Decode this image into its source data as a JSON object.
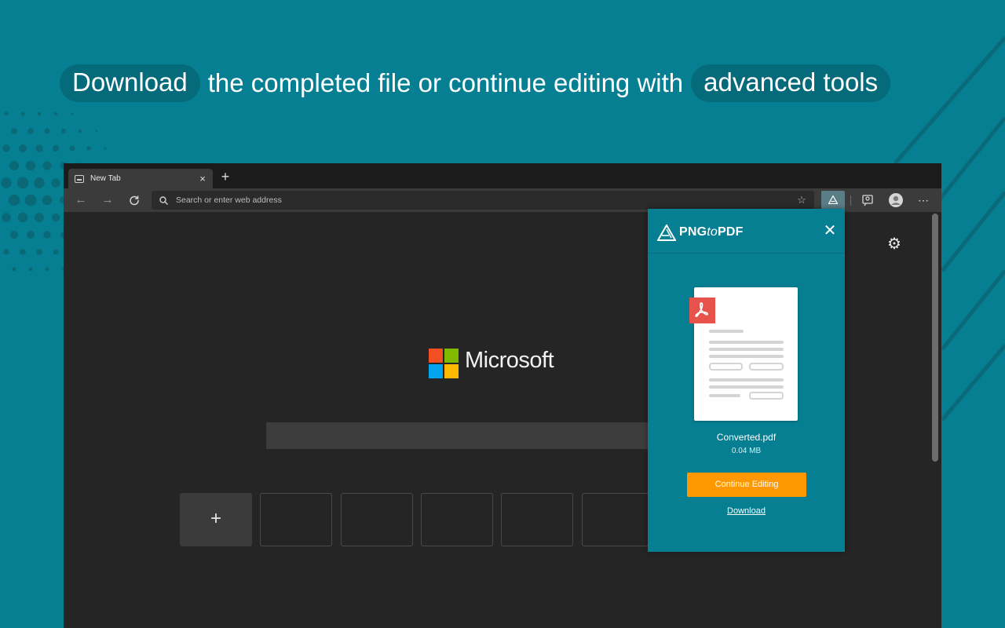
{
  "headline": {
    "highlight_1": "Download",
    "middle": "the completed file or continue editing with",
    "highlight_2": "advanced tools"
  },
  "browser": {
    "tab": {
      "title": "New Tab",
      "close_glyph": "×"
    },
    "new_tab_glyph": "+",
    "address_placeholder": "Search or enter web address",
    "nav": {
      "back_glyph": "←",
      "forward_glyph": "→"
    },
    "more_glyph": "⋯"
  },
  "page": {
    "logo_text": "Microsoft",
    "add_tile_glyph": "+",
    "settings_glyph": "⚙"
  },
  "popup": {
    "brand_prefix": "PNG",
    "brand_to": "to",
    "brand_suffix": "PDF",
    "close_glyph": "✕",
    "file_name": "Converted.pdf",
    "file_size": "0.04 MB",
    "continue_label": "Continue Editing",
    "download_label": "Download"
  },
  "colors": {
    "background": "#057f91",
    "pill": "#056b7b",
    "accent_orange": "#ff9800",
    "pdf_red": "#e5534b",
    "ms_red": "#f25022",
    "ms_green": "#7fba00",
    "ms_blue": "#00a4ef",
    "ms_yellow": "#ffb900"
  },
  "icons": [
    "tab-page-icon",
    "search-icon",
    "star-icon",
    "pngtopdf-extension-icon",
    "feedback-icon",
    "profile-icon",
    "more-icon",
    "gear-icon",
    "pdf-icon",
    "close-icon",
    "refresh-icon"
  ]
}
